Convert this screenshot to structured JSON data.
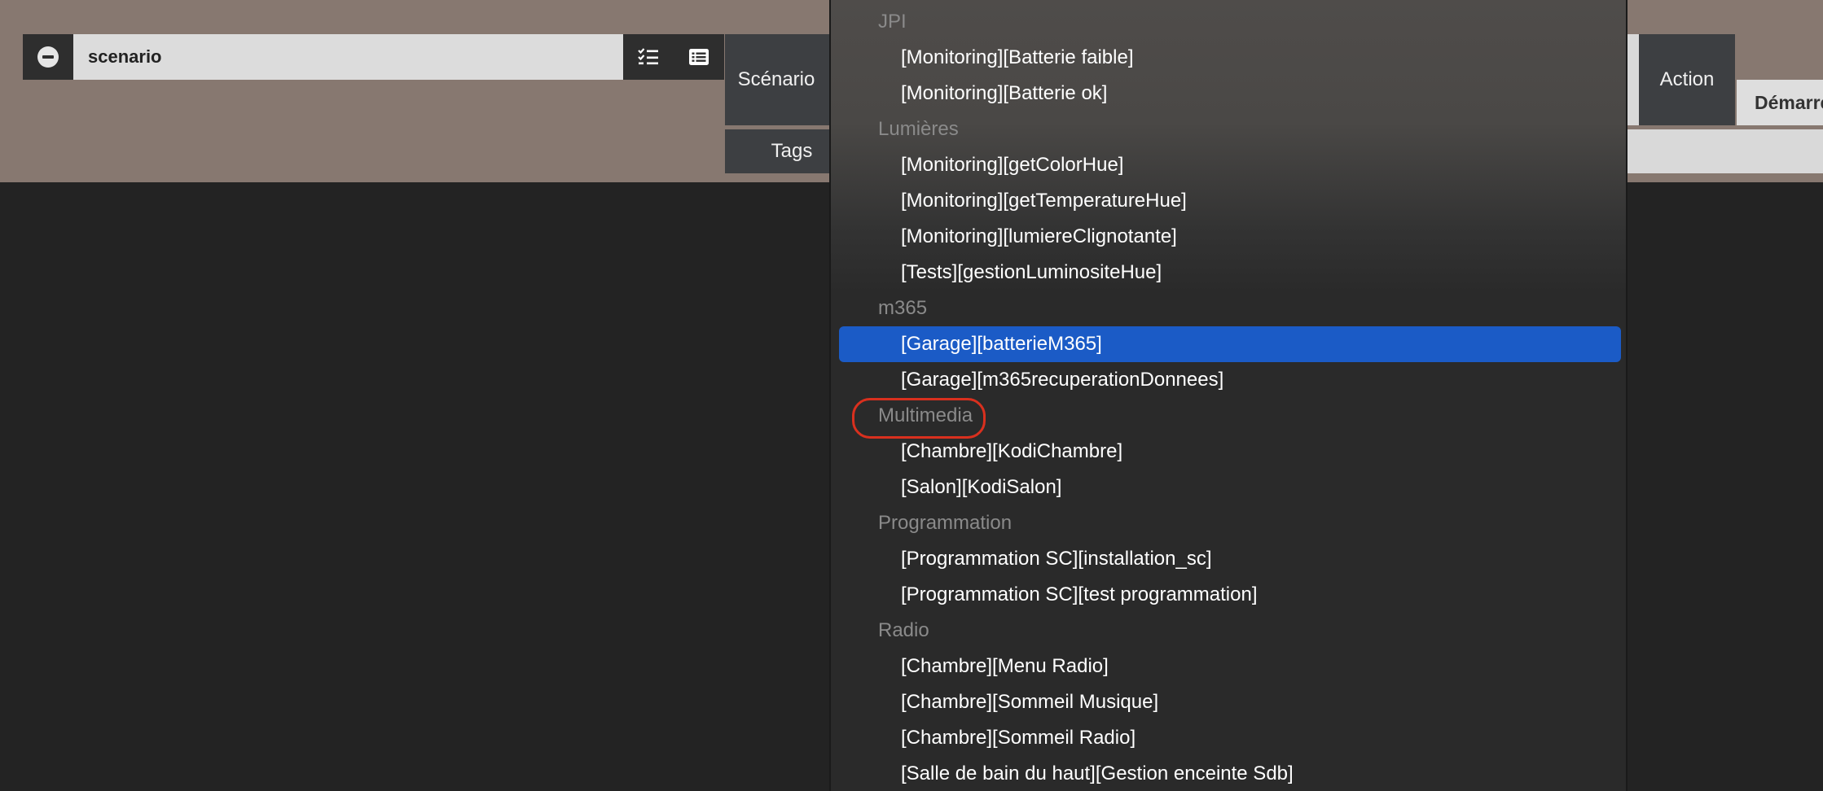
{
  "toolbar": {
    "search_value": "scenario",
    "remove_icon": "minus-circle-icon",
    "checklist_icon": "checklist-icon",
    "list_icon": "list-icon"
  },
  "tabs": {
    "scenario": "Scénario",
    "tags": "Tags",
    "action": "Action",
    "demarre": "Démarre"
  },
  "dropdown": {
    "groups": [
      {
        "label": "JPI",
        "items": [
          "[Monitoring][Batterie faible]",
          "[Monitoring][Batterie ok]"
        ]
      },
      {
        "label": "Lumières",
        "items": [
          "[Monitoring][getColorHue]",
          "[Monitoring][getTemperatureHue]",
          "[Monitoring][lumiereClignotante]",
          "[Tests][gestionLuminositeHue]"
        ]
      },
      {
        "label": "m365",
        "items": [
          "[Garage][batterieM365]",
          "[Garage][m365recuperationDonnees]"
        ]
      },
      {
        "label": "Multimedia",
        "items": [
          "[Chambre][KodiChambre]",
          "[Salon][KodiSalon]"
        ]
      },
      {
        "label": "Programmation",
        "items": [
          "[Programmation SC][installation_sc]",
          "[Programmation SC][test programmation]"
        ]
      },
      {
        "label": "Radio",
        "items": [
          "[Chambre][Menu Radio]",
          "[Chambre][Sommeil Musique]",
          "[Chambre][Sommeil Radio]",
          "[Salle de bain du haut][Gestion enceinte Sdb]"
        ]
      }
    ],
    "selected_item": "[Garage][batterieM365]",
    "highlighted_group": "Multimedia"
  },
  "colors": {
    "selection": "#1b5bc6",
    "highlight_ring": "#d9301e",
    "header_band": "#877870"
  }
}
